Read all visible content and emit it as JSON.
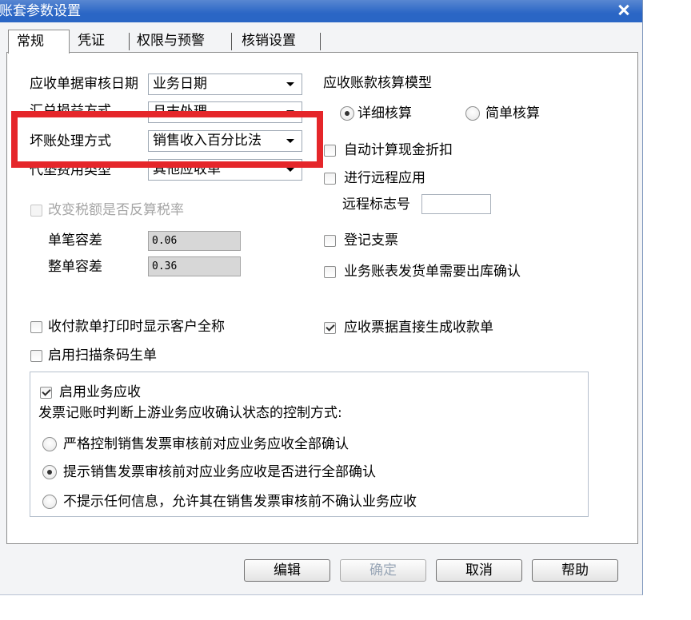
{
  "window": {
    "title": "账套参数设置",
    "close_icon": "close-icon"
  },
  "colors": {
    "title_bar": "#2a66c5",
    "highlight_box": "#e5262a"
  },
  "tabs": [
    {
      "label": "常规",
      "selected": true
    },
    {
      "label": "凭证",
      "selected": false
    },
    {
      "label": "权限与预警",
      "selected": false
    },
    {
      "label": "核销设置",
      "selected": false
    }
  ],
  "general": {
    "audit_date": {
      "label": "应收单据审核日期",
      "value": "业务日期",
      "icon": "dropdown-arrow-icon"
    },
    "exchange_method": {
      "label": "汇兑损益方式",
      "value": "月末处理",
      "icon": "dropdown-arrow-icon"
    },
    "bad_debt_method": {
      "label": "坏账处理方式",
      "value": "销售收入百分比法",
      "icon": "dropdown-arrow-icon"
    },
    "advance_fee_type": {
      "label": "代垫费用类型",
      "value": "其他应收单",
      "icon": "dropdown-arrow-icon"
    },
    "recalc_tax_rate": {
      "label": "改变税额是否反算税率",
      "checked": false,
      "disabled": true
    },
    "single_tolerance": {
      "label": "单笔容差",
      "value": "0.06",
      "disabled": true
    },
    "whole_tolerance": {
      "label": "整单容差",
      "value": "0.36",
      "disabled": true
    },
    "print_customer_full_name": {
      "label": "收付款单打印时显示客户全称",
      "checked": false
    },
    "scan_barcode": {
      "label": "启用扫描条码生单",
      "checked": false
    },
    "model": {
      "label": "应收账款核算模型",
      "options": [
        {
          "label": "详细核算",
          "selected": true
        },
        {
          "label": "简单核算",
          "selected": false
        }
      ]
    },
    "auto_cash_discount": {
      "label": "自动计算现金折扣",
      "checked": false
    },
    "remote_app": {
      "label": "进行远程应用",
      "checked": false
    },
    "remote_id": {
      "label": "远程标志号"
    },
    "register_check": {
      "label": "登记支票",
      "checked": false
    },
    "delivery_confirm": {
      "label": "业务账表发货单需要出库确认",
      "checked": false
    },
    "note_to_receipt": {
      "label": "应收票据直接生成收款单",
      "checked": true
    },
    "business_receivable": {
      "enable": {
        "label": "启用业务应收",
        "checked": true
      },
      "control_label": "发票记账时判断上游业务应收确认状态的控制方式:",
      "options": [
        {
          "label": "严格控制销售发票审核前对应业务应收全部确认",
          "selected": false
        },
        {
          "label": "提示销售发票审核前对应业务应收是否进行全部确认",
          "selected": true
        },
        {
          "label": "不提示任何信息，允许其在销售发票审核前不确认业务应收",
          "selected": false
        }
      ]
    }
  },
  "buttons": {
    "edit": {
      "label": "编辑",
      "disabled": false
    },
    "ok": {
      "label": "确定",
      "disabled": true
    },
    "cancel": {
      "label": "取消",
      "disabled": false
    },
    "help": {
      "label": "帮助",
      "disabled": false
    }
  }
}
